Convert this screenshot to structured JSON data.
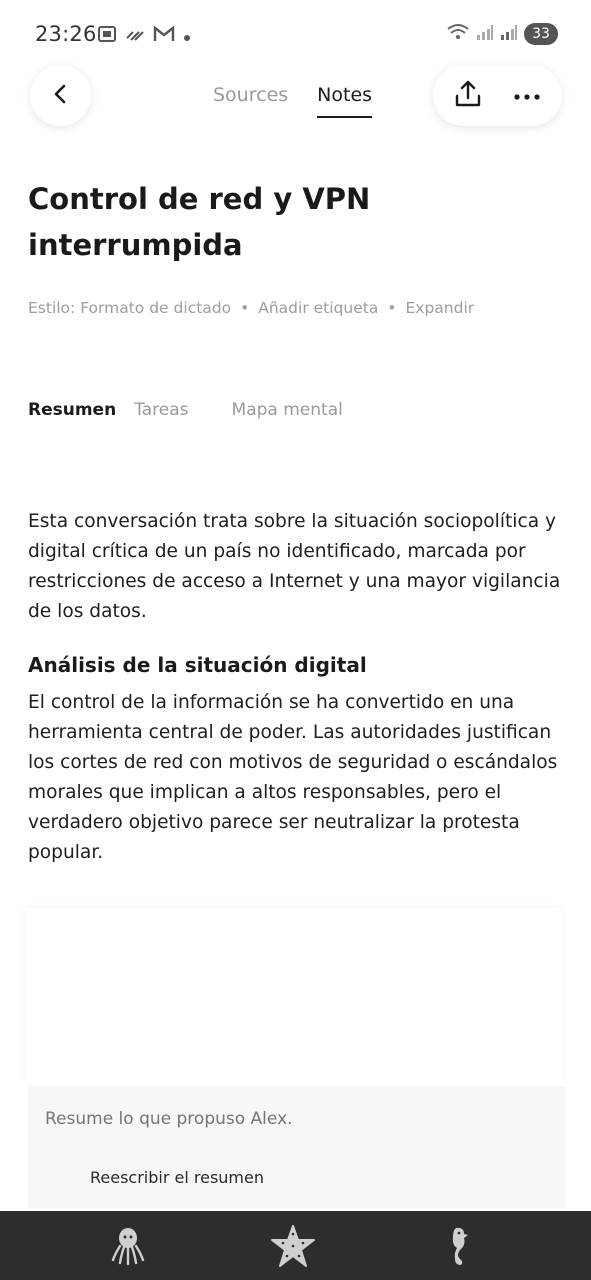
{
  "status_bar": {
    "time": "23:26",
    "battery": "33",
    "icons_left": [
      "photo-icon",
      "signal-stripes-icon",
      "gmail-icon",
      "dot-icon"
    ],
    "icons_right": [
      "wifi-icon",
      "signal-icon",
      "signal-r-icon",
      "battery-icon"
    ]
  },
  "header": {
    "tabs": [
      {
        "label": "Sources",
        "active": false
      },
      {
        "label": "Notes",
        "active": true
      }
    ],
    "icons": [
      "back-icon",
      "share-icon",
      "more-icon"
    ]
  },
  "note": {
    "title": "Control de red y VPN interrumpida",
    "meta": {
      "style": "Estilo: Formato de dictado",
      "add_tag": "Añadir etiqueta",
      "expand": "Expandir",
      "separator": "•"
    },
    "view_tabs": [
      {
        "label": "Resumen",
        "active": true
      },
      {
        "label": "Tareas",
        "active": false
      },
      {
        "label": "Mapa mental",
        "active": false
      }
    ],
    "summary_intro": "Esta conversación trata sobre la situación sociopolítica y digital crítica de un país no identificado, marcada por restricciones de acceso a Internet y una mayor vigilancia de los datos.",
    "section_heading": "Análisis de la situación digital",
    "section_text": "El control de la información se ha convertido en una herramienta central de poder. Las autoridades justifican los cortes de red con motivos de seguridad o escándalos morales que implican a altos responsables, pero el verdadero objetivo parece ser neutralizar la protesta popular."
  },
  "prompt": {
    "placeholder": "Resume lo que propuso Alex.",
    "rewrite_label": "Reescribir el resumen"
  },
  "bottom_nav": {
    "items": [
      "octopus-icon",
      "starfish-icon",
      "seahorse-icon"
    ],
    "colors": {
      "background": "#2d2d2d",
      "icon": "#cfcfcf"
    }
  }
}
